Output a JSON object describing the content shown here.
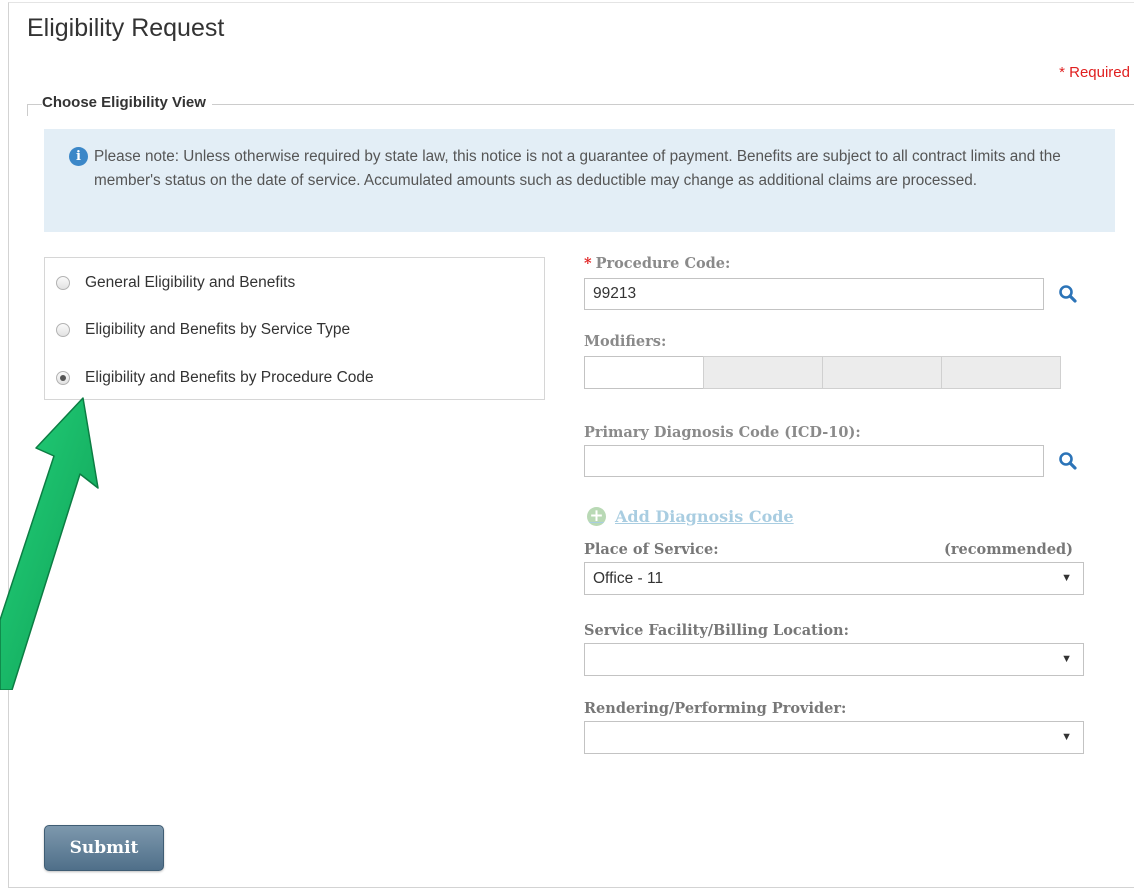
{
  "page": {
    "title": "Eligibility Request",
    "required_note": "* Required"
  },
  "section": {
    "legend": "Choose Eligibility View",
    "notice": "Please note: Unless otherwise required by state law, this notice is not a guarantee of payment. Benefits are subject to all contract limits and the member's status on the date of service. Accumulated amounts such as deductible may change as additional claims are processed."
  },
  "views": [
    {
      "label": "General Eligibility and Benefits",
      "selected": false
    },
    {
      "label": "Eligibility and Benefits by Service Type",
      "selected": false
    },
    {
      "label": "Eligibility and Benefits by Procedure Code",
      "selected": true
    }
  ],
  "form": {
    "procedure_code": {
      "required_mark": "*",
      "label": "Procedure Code:",
      "value": "99213"
    },
    "modifiers": {
      "label": "Modifiers:",
      "values": [
        "",
        "",
        "",
        ""
      ]
    },
    "primary_diagnosis": {
      "label": "Primary Diagnosis Code (ICD-10):",
      "value": ""
    },
    "add_diagnosis": {
      "label": "Add Diagnosis Code"
    },
    "place_of_service": {
      "label": "Place of Service:",
      "hint": "(recommended)",
      "value": "Office - 11"
    },
    "service_facility": {
      "label": "Service Facility/Billing Location:",
      "value": ""
    },
    "rendering_provider": {
      "label": "Rendering/Performing Provider:",
      "value": ""
    }
  },
  "submit": {
    "label": "Submit"
  },
  "icons": {
    "info": "info-icon",
    "search": "search-icon",
    "add": "plus-circle-icon",
    "dropdown": "chevron-down-icon",
    "annotation": "green-arrow-icon"
  },
  "colors": {
    "required": "#e01f1f",
    "notice_bg": "#e3eef6",
    "link": "#a9cde1",
    "button": "#5a7a93",
    "arrow": "#17b864"
  }
}
